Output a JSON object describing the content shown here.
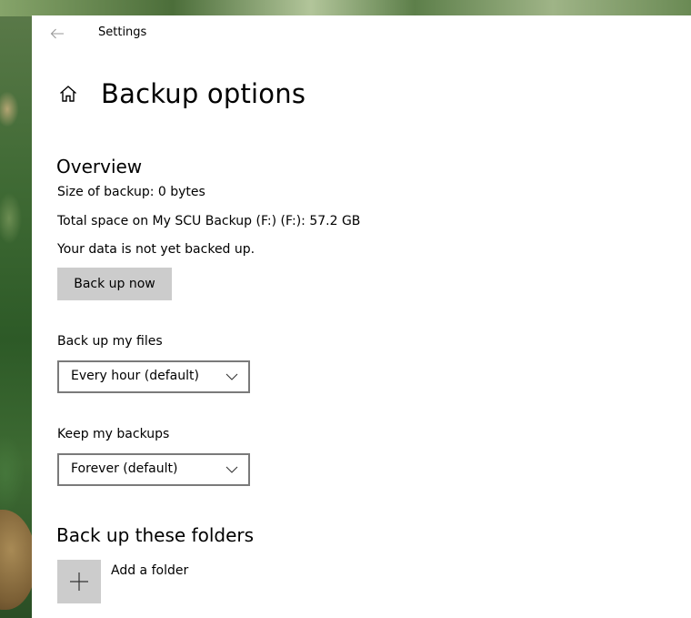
{
  "window": {
    "app_title": "Settings"
  },
  "page": {
    "title": "Backup options"
  },
  "overview": {
    "heading": "Overview",
    "size_of_backup": "Size of backup: 0 bytes",
    "total_space": "Total space on My SCU Backup (F:) (F:): 57.2 GB",
    "status": "Your data is not yet backed up.",
    "back_up_now_label": "Back up now"
  },
  "frequency": {
    "label": "Back up my files",
    "selected": "Every hour (default)"
  },
  "retention": {
    "label": "Keep my backups",
    "selected": "Forever (default)"
  },
  "folders": {
    "heading": "Back up these folders",
    "add_label": "Add a folder"
  },
  "icons": {
    "back": "back-arrow-icon",
    "home": "home-icon",
    "chevron": "chevron-down-icon",
    "add": "plus-icon"
  },
  "colors": {
    "button_bg": "#cccccc",
    "dropdown_border": "#7a7a7a",
    "window_bg": "#ffffff"
  }
}
